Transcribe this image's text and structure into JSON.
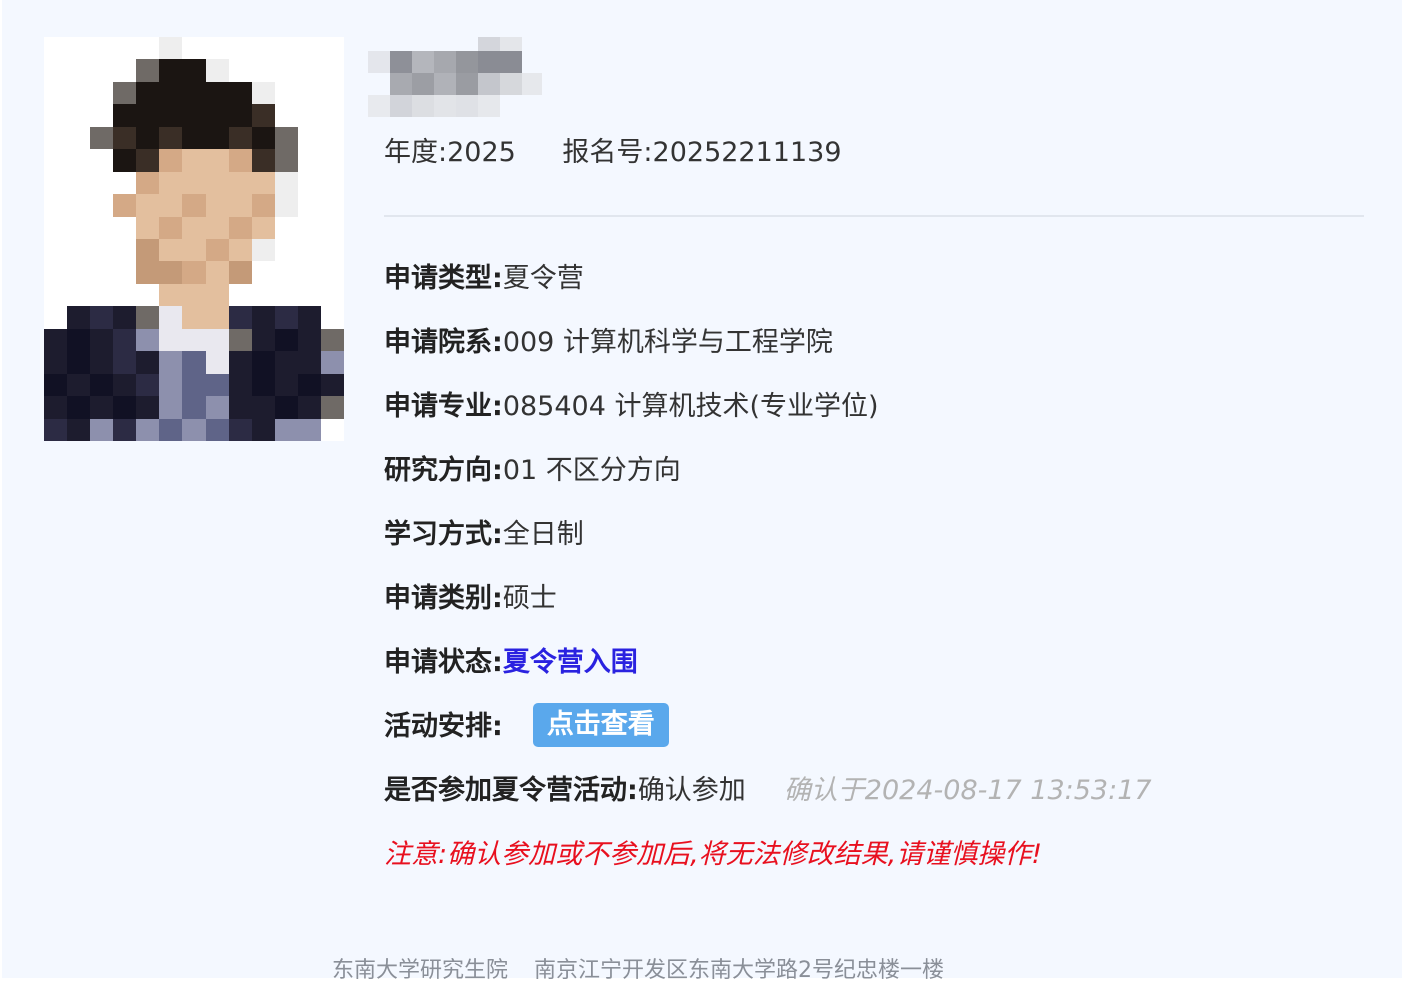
{
  "header": {
    "year_label": "年度:",
    "year_value": "2025",
    "reg_label": "报名号:",
    "reg_value": "20252211139"
  },
  "fields": [
    {
      "label": "申请类型:",
      "value": "夏令营"
    },
    {
      "label": "申请院系:",
      "value": "009 计算机科学与工程学院"
    },
    {
      "label": "申请专业:",
      "value": "085404 计算机技术(专业学位)"
    },
    {
      "label": "研究方向:",
      "value": "01 不区分方向"
    },
    {
      "label": "学习方式:",
      "value": "全日制"
    },
    {
      "label": "申请类别:",
      "value": "硕士"
    }
  ],
  "status": {
    "label": "申请状态:",
    "value": "夏令营入围",
    "color": "#2a22e0"
  },
  "activity": {
    "label": "活动安排:",
    "button_label": "点击查看",
    "button_color": "#5aa8ec"
  },
  "participation": {
    "label": "是否参加夏令营活动:",
    "value": "确认参加",
    "confirmed_at": "确认于2024-08-17 13:53:17"
  },
  "notice": {
    "text": "注意:确认参加或不参加后,将无法修改结果,请谨慎操作!",
    "color": "#e8101f"
  },
  "footer": {
    "org": "东南大学研究生院",
    "address": "南京江宁开发区东南大学路2号纪忠楼一楼"
  }
}
